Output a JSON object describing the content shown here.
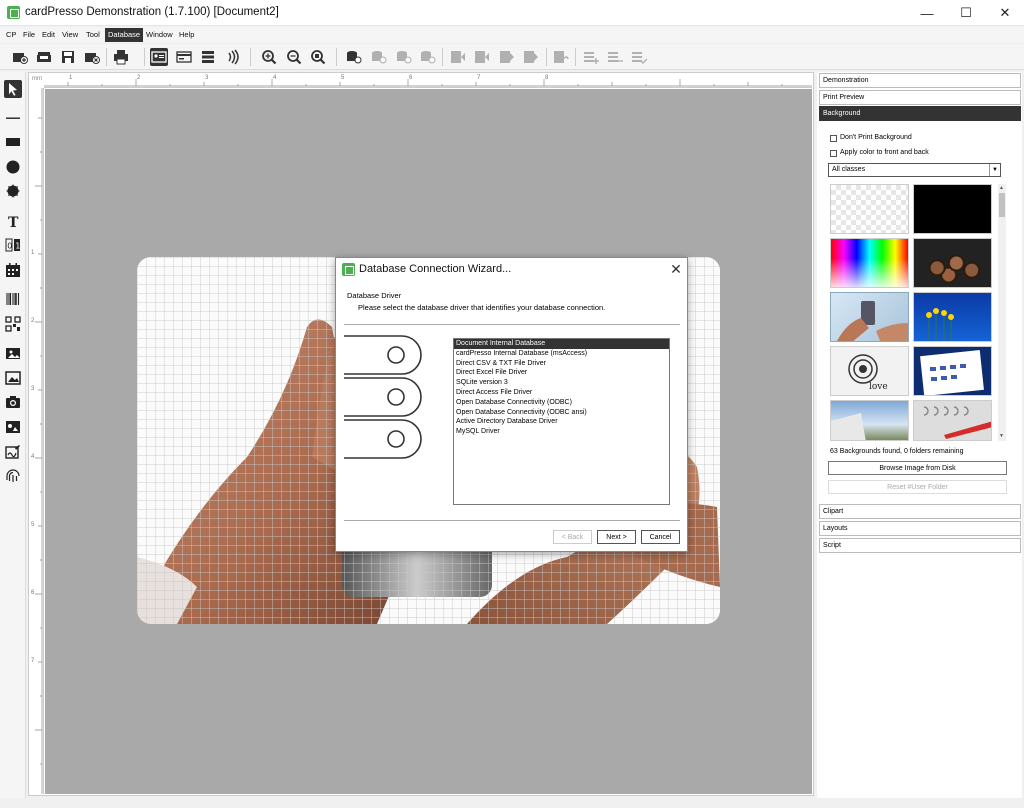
{
  "window": {
    "title": "cardPresso Demonstration (1.7.100) [Document2]",
    "minimize": "—",
    "maximize": "☐",
    "close": "✕"
  },
  "menu": {
    "logo": "CP",
    "items": [
      "File",
      "Edit",
      "View",
      "Tool",
      "Database",
      "Window",
      "Help"
    ],
    "active": "Database"
  },
  "toolbar": {
    "icons": [
      "new-document-icon",
      "open-icon",
      "save-icon",
      "close-document-icon",
      "print-icon",
      "card-front-icon",
      "card-back-icon",
      "magstripe-icon",
      "contactless-icon",
      "zoom-in-icon",
      "zoom-out-icon",
      "zoom-fit-icon",
      "db-view-icon",
      "db-first-icon",
      "db-prev-icon",
      "db-next-icon",
      "db-last-icon",
      "db-refresh-icon",
      "db-add-icon",
      "db-remove-icon",
      "db-ok-icon"
    ]
  },
  "tools": [
    "select-icon",
    "line-icon",
    "rectangle-icon",
    "ellipse-icon",
    "star-icon",
    "text-icon",
    "counter-icon",
    "calendar-icon",
    "barcode-icon",
    "qrcode-icon",
    "image-photo-icon",
    "image-icon",
    "camera-icon",
    "signature-icon",
    "fingerprint-icon"
  ],
  "ruler": {
    "top_label": "mm",
    "top_ticks": [
      "1",
      "2",
      "3",
      "4",
      "5",
      "6",
      "7",
      "8"
    ],
    "left_ticks": [
      "1",
      "2",
      "3",
      "4",
      "5",
      "6",
      "7"
    ]
  },
  "dialog": {
    "title": "Database Connection Wizard...",
    "heading": "Database Driver",
    "description": "Please select the database driver that identifies your database connection.",
    "drivers": [
      "Document Internal Database",
      "cardPresso Internal Database (msAccess)",
      "Direct CSV & TXT File Driver",
      "Direct Excel File Driver",
      "SQLite version 3",
      "Direct Access File Driver",
      "Open Database Connectivity (ODBC)",
      "Open Database Connectivity (ODBC ansi)",
      "Active Directory Database Driver",
      "MySQL Driver"
    ],
    "selected_index": 0,
    "back_label": "< Back",
    "next_label": "Next >",
    "cancel_label": "Cancel"
  },
  "right_panel": {
    "sections_top": [
      "Demonstration",
      "Print Preview",
      "Background"
    ],
    "active_section": "Background",
    "options": {
      "dont_print": "Don't Print Background",
      "apply_color": "Apply color to front and back"
    },
    "class_select": "All classes",
    "thumbnails": [
      "transparent",
      "black",
      "color-spectrum",
      "wood-logs",
      "hands-phone",
      "yellow-flowers",
      "love-target",
      "calendar",
      "building-sky",
      "notebook-pen"
    ],
    "count_text": "63 Backgrounds found, 0 folders remaining",
    "browse_label": "Browse Image from Disk",
    "reset_label": "Reset #User Folder",
    "sections_bottom": [
      "Clipart",
      "Layouts",
      "Script"
    ]
  },
  "colors": {
    "brand_green": "#4caf50",
    "active_dark": "#333333",
    "workspace_grey": "#a9a9a9"
  }
}
